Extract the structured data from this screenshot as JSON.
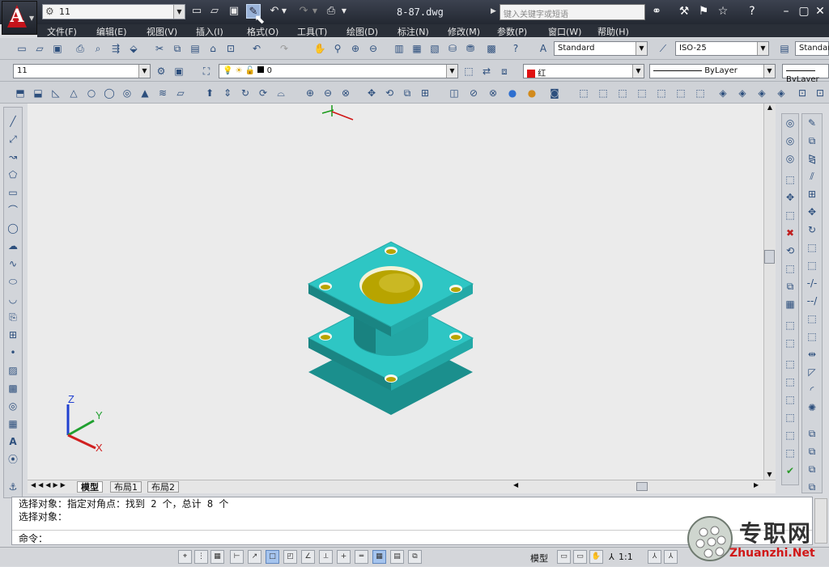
{
  "app": {
    "logo_letter": "A",
    "title": "8-87.dwg"
  },
  "workspace": {
    "value": "11"
  },
  "search": {
    "placeholder": "键入关键字或短语"
  },
  "menus": [
    "文件(F)",
    "编辑(E)",
    "视图(V)",
    "插入(I)",
    "格式(O)",
    "工具(T)",
    "绘图(D)",
    "标注(N)",
    "修改(M)",
    "参数(P)",
    "窗口(W)",
    "帮助(H)"
  ],
  "styles": {
    "text_style": "Standard",
    "dim_style": "ISO-25",
    "table_style": "Standard"
  },
  "layers": {
    "workspace": "11",
    "layer": "0",
    "color": "红",
    "linetype": "ByLayer",
    "lineweight": "ByLayer"
  },
  "layout_tabs": [
    "模型",
    "布局1",
    "布局2"
  ],
  "command_lines": [
    "选择对象：指定对角点：找到 2 个，总计 8 个",
    "选择对象：",
    "命令："
  ],
  "status": {
    "model_label": "模型",
    "annotation_scale": "1:1"
  },
  "axis_labels": {
    "x": "X",
    "y": "Y",
    "z": "Z"
  },
  "watermark": {
    "cn": "专职网",
    "en": "Zhuanzhi.Net"
  },
  "colors": {
    "model_face": "#2ec6c4",
    "model_dark": "#1b8f8d",
    "bore": "#b8a400",
    "layer_red": "#e01010"
  }
}
